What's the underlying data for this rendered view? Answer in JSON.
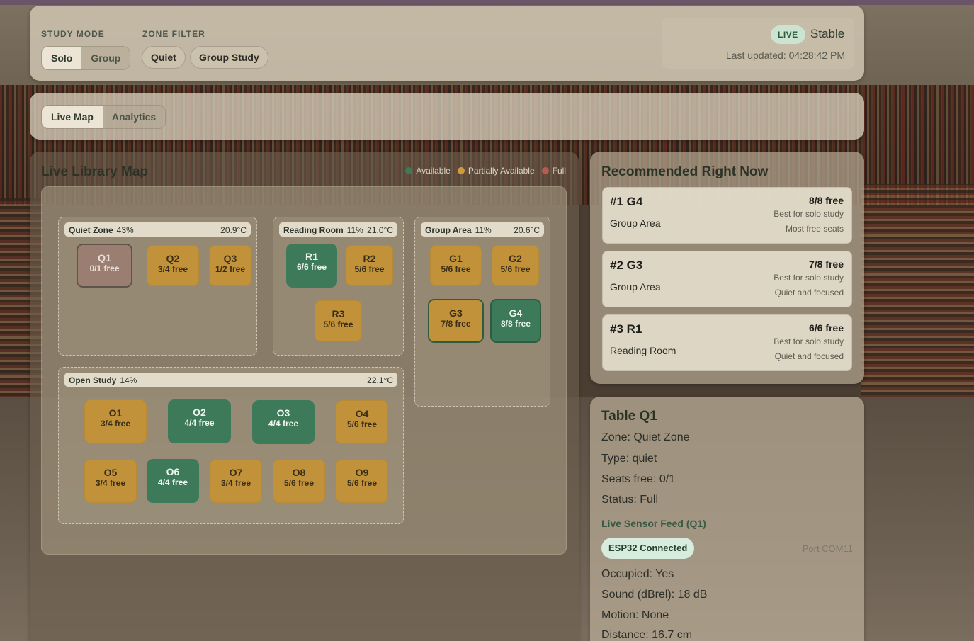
{
  "header": {
    "study_mode_label": "STUDY MODE",
    "study_mode_options": [
      "Solo",
      "Group"
    ],
    "zone_filter_label": "ZONE FILTER",
    "zone_filters": [
      "Quiet",
      "Group Study"
    ],
    "live_badge": "LIVE",
    "stability": "Stable",
    "last_updated": "Last updated: 04:28:42 PM"
  },
  "tabs": [
    "Live Map",
    "Analytics"
  ],
  "map": {
    "title": "Live Library Map",
    "legend": [
      {
        "label": "Available",
        "color": "#3d7a5a"
      },
      {
        "label": "Partially Available",
        "color": "#d29a3a"
      },
      {
        "label": "Full",
        "color": "#b95a4e"
      }
    ],
    "zones": {
      "quiet": {
        "name": "Quiet Zone",
        "pct": "43%",
        "temp": "20.9°C"
      },
      "reading": {
        "name": "Reading Room",
        "pct": "11%",
        "temp": "21.0°C"
      },
      "group": {
        "name": "Group Area",
        "pct": "11%",
        "temp": "20.6°C"
      },
      "open": {
        "name": "Open Study",
        "pct": "14%",
        "temp": "22.1°C"
      }
    },
    "tables": {
      "Q1": {
        "id": "Q1",
        "free": "0/1 free",
        "status": "full"
      },
      "Q2": {
        "id": "Q2",
        "free": "3/4 free",
        "status": "partial"
      },
      "Q3": {
        "id": "Q3",
        "free": "1/2 free",
        "status": "partial"
      },
      "R1": {
        "id": "R1",
        "free": "6/6 free",
        "status": "available"
      },
      "R2": {
        "id": "R2",
        "free": "5/6 free",
        "status": "partial"
      },
      "R3": {
        "id": "R3",
        "free": "5/6 free",
        "status": "partial"
      },
      "G1": {
        "id": "G1",
        "free": "5/6 free",
        "status": "partial"
      },
      "G2": {
        "id": "G2",
        "free": "5/6 free",
        "status": "partial"
      },
      "G3": {
        "id": "G3",
        "free": "7/8 free",
        "status": "partial"
      },
      "G4": {
        "id": "G4",
        "free": "8/8 free",
        "status": "available"
      },
      "O1": {
        "id": "O1",
        "free": "3/4 free",
        "status": "partial"
      },
      "O2": {
        "id": "O2",
        "free": "4/4 free",
        "status": "available"
      },
      "O3": {
        "id": "O3",
        "free": "4/4 free",
        "status": "available"
      },
      "O4": {
        "id": "O4",
        "free": "5/6 free",
        "status": "partial"
      },
      "O5": {
        "id": "O5",
        "free": "3/4 free",
        "status": "partial"
      },
      "O6": {
        "id": "O6",
        "free": "4/4 free",
        "status": "available"
      },
      "O7": {
        "id": "O7",
        "free": "3/4 free",
        "status": "partial"
      },
      "O8": {
        "id": "O8",
        "free": "5/6 free",
        "status": "partial"
      },
      "O9": {
        "id": "O9",
        "free": "5/6 free",
        "status": "partial"
      }
    }
  },
  "recommendations": {
    "title": "Recommended Right Now",
    "items": [
      {
        "rank": "#1 G4",
        "zone": "Group Area",
        "free": "8/8 free",
        "note1": "Best for solo study",
        "note2": "Most free seats"
      },
      {
        "rank": "#2 G3",
        "zone": "Group Area",
        "free": "7/8 free",
        "note1": "Best for solo study",
        "note2": "Quiet and focused"
      },
      {
        "rank": "#3 R1",
        "zone": "Reading Room",
        "free": "6/6 free",
        "note1": "Best for solo study",
        "note2": "Quiet and focused"
      }
    ]
  },
  "detail": {
    "title": "Table Q1",
    "zone": "Zone: Quiet Zone",
    "type": "Type: quiet",
    "seats": "Seats free: 0/1",
    "status": "Status: Full",
    "sensor_title": "Live Sensor Feed (Q1)",
    "esp": "ESP32 Connected",
    "port": "Port COM11",
    "occupied": "Occupied: Yes",
    "sound": "Sound (dBrel): 18 dB",
    "motion": "Motion: None",
    "distance": "Distance: 16.7 cm"
  }
}
